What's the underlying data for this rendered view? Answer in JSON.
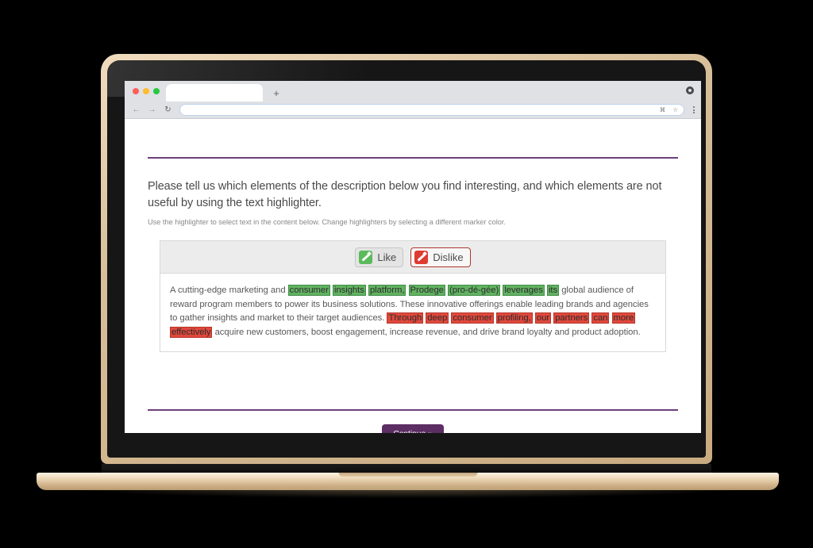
{
  "browser": {
    "traffic_lights": [
      "red",
      "yellow",
      "green"
    ],
    "tab_title": "",
    "new_tab_label": "+",
    "back_icon": "←",
    "forward_icon": "→",
    "reload_icon": "↻",
    "address_value": "",
    "address_placeholder": "",
    "omnibox_command_icon": "⌘",
    "omnibox_star_icon": "☆"
  },
  "survey": {
    "title": "Please tell us which elements of the description below you find interesting, and which elements are not useful by using the text highlighter.",
    "subtitle": "Use the highlighter to select text in the content below. Change highlighters by selecting a different marker color.",
    "toolbar": {
      "like_label": "Like",
      "dislike_label": "Dislike",
      "like_color": "#5bba5b",
      "dislike_color": "#e03b30",
      "active_marker": "dislike"
    },
    "content_segments": [
      {
        "text": "A cutting-edge marketing and ",
        "mark": "none"
      },
      {
        "text": "consumer",
        "mark": "like"
      },
      {
        "text": " ",
        "mark": "none"
      },
      {
        "text": "insights",
        "mark": "like"
      },
      {
        "text": " ",
        "mark": "none"
      },
      {
        "text": "platform,",
        "mark": "like"
      },
      {
        "text": " ",
        "mark": "none"
      },
      {
        "text": "Prodege",
        "mark": "like"
      },
      {
        "text": " ",
        "mark": "none"
      },
      {
        "text": "(pro-dé-gée)",
        "mark": "like"
      },
      {
        "text": " ",
        "mark": "none"
      },
      {
        "text": "leverages",
        "mark": "like"
      },
      {
        "text": " ",
        "mark": "none"
      },
      {
        "text": "its",
        "mark": "like"
      },
      {
        "text": " global audience of reward program members to power its business solutions. These innovative offerings enable leading brands and agencies to gather insights and market to their target audiences. ",
        "mark": "none"
      },
      {
        "text": "Through",
        "mark": "dislike"
      },
      {
        "text": " ",
        "mark": "none"
      },
      {
        "text": "deep",
        "mark": "dislike"
      },
      {
        "text": " ",
        "mark": "none"
      },
      {
        "text": "consumer",
        "mark": "dislike"
      },
      {
        "text": " ",
        "mark": "none"
      },
      {
        "text": "profiling,",
        "mark": "dislike"
      },
      {
        "text": " ",
        "mark": "none"
      },
      {
        "text": "our",
        "mark": "dislike"
      },
      {
        "text": " ",
        "mark": "none"
      },
      {
        "text": "partners",
        "mark": "dislike"
      },
      {
        "text": " ",
        "mark": "none"
      },
      {
        "text": "can",
        "mark": "dislike"
      },
      {
        "text": " ",
        "mark": "none"
      },
      {
        "text": "more",
        "mark": "dislike"
      },
      {
        "text": " ",
        "mark": "none"
      },
      {
        "text": "effectively",
        "mark": "dislike"
      },
      {
        "text": " acquire new customers, boost engagement, increase revenue, and drive brand loyalty and product adoption.",
        "mark": "none"
      }
    ],
    "continue_label": "Continue »",
    "accent_color": "#6b3f7a",
    "button_color": "#5c2e63"
  }
}
